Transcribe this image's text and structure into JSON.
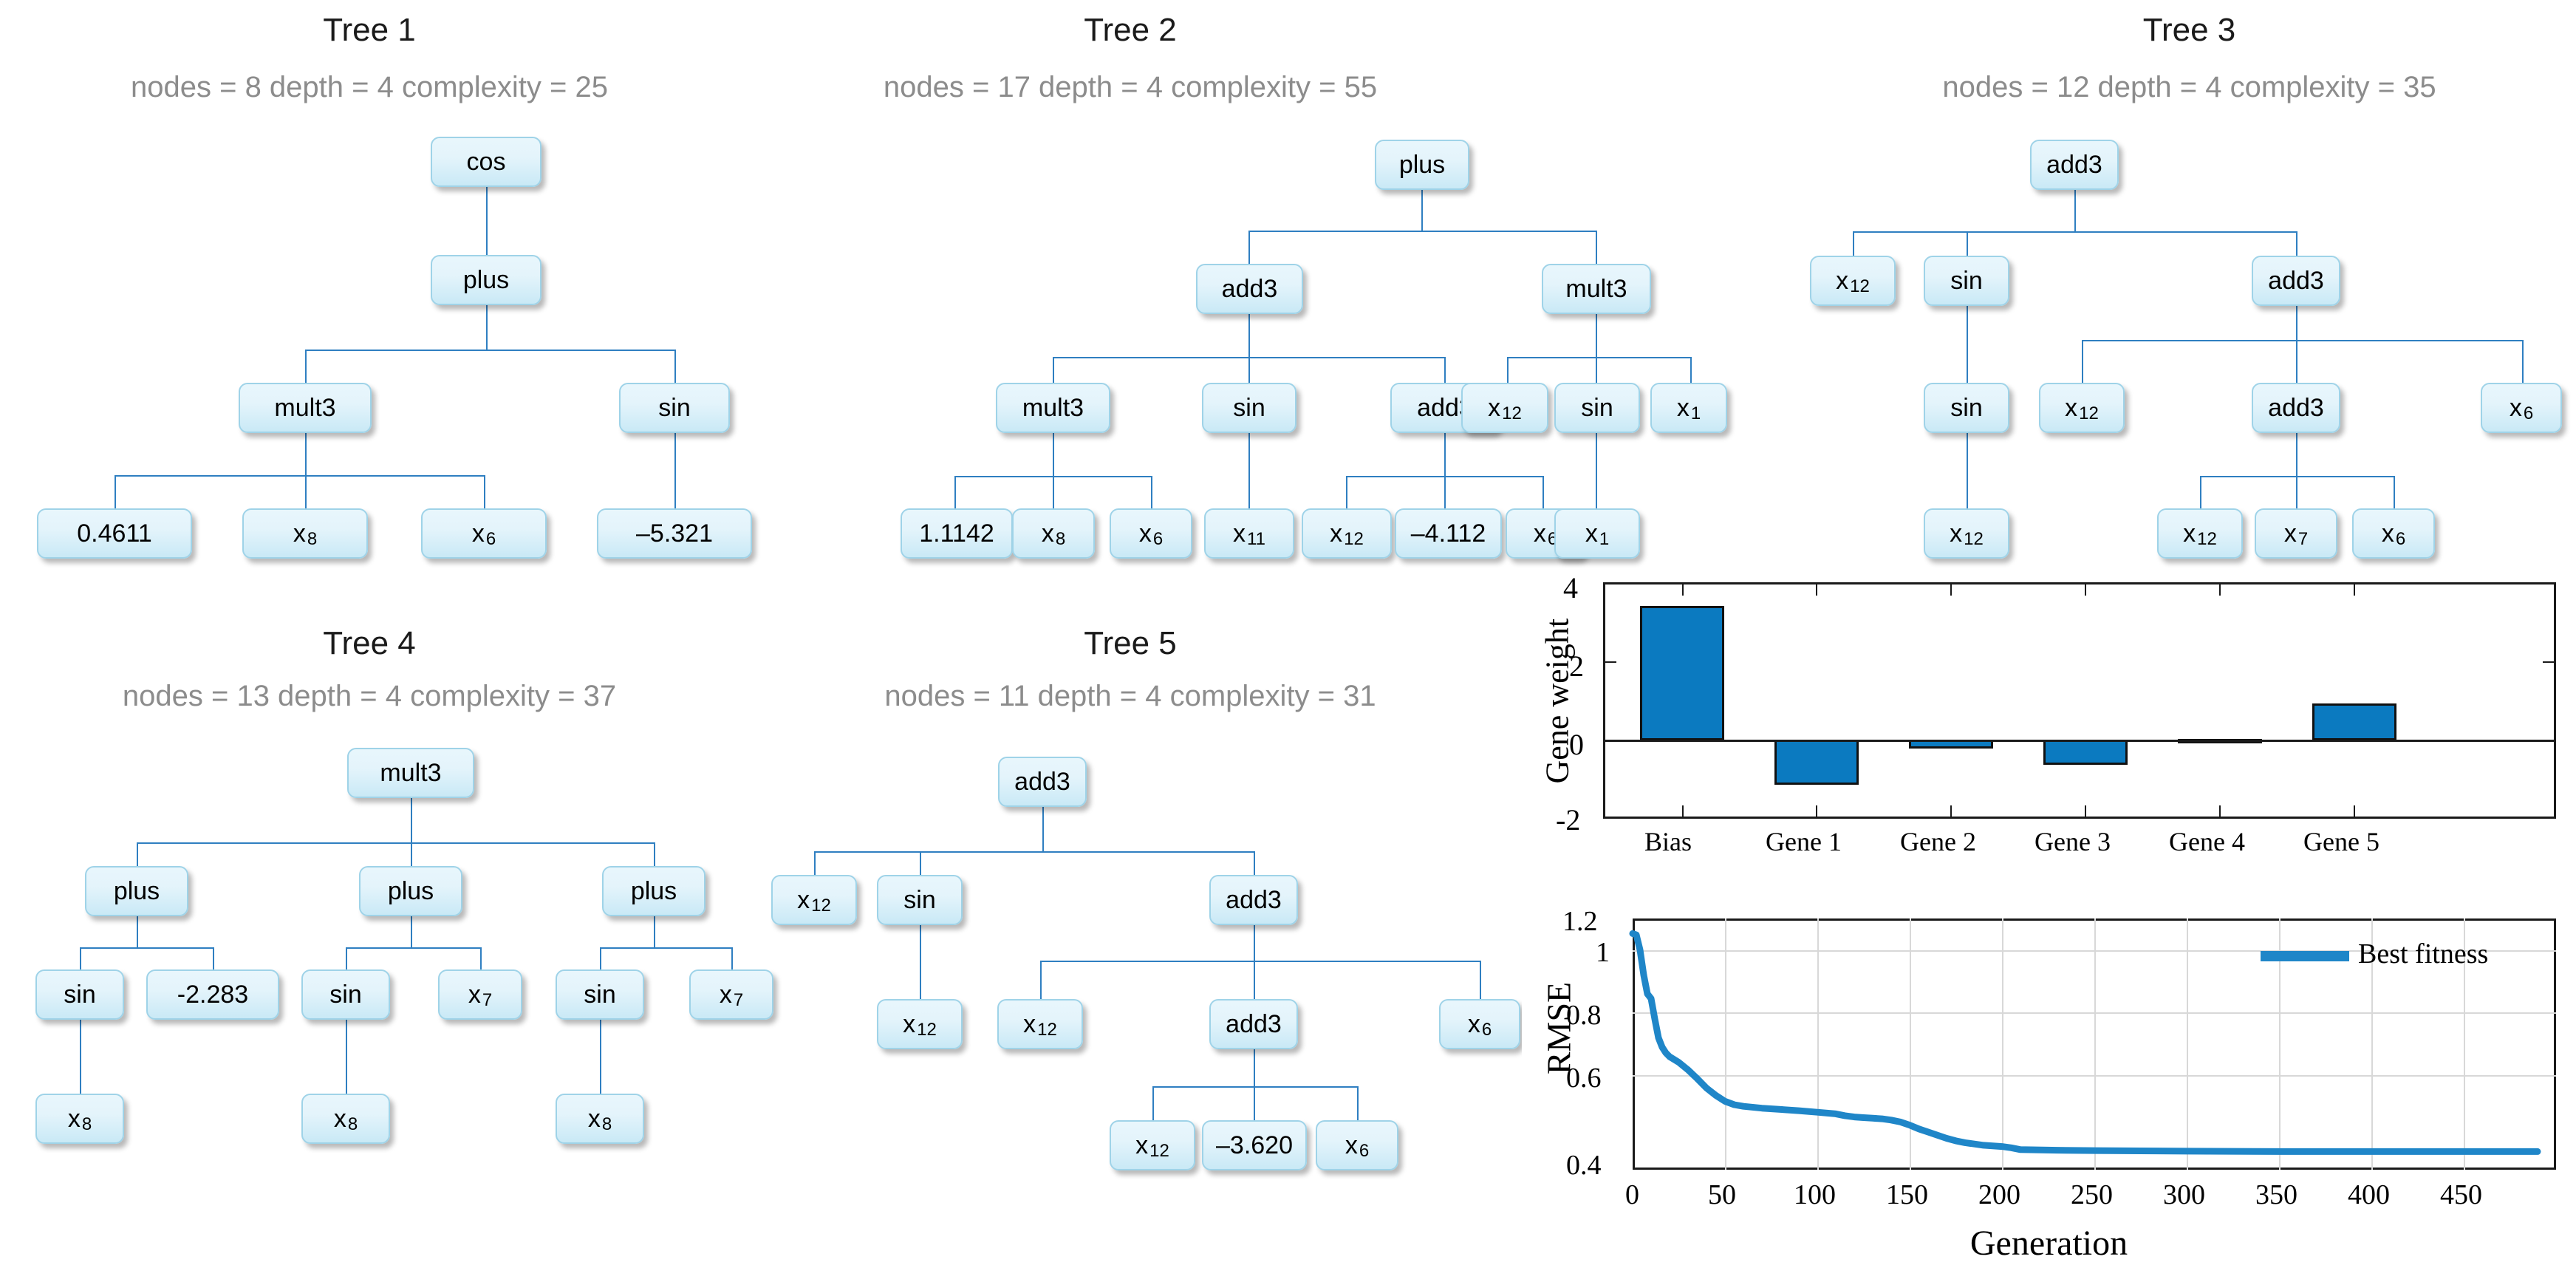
{
  "trees": [
    {
      "id": "tree-1",
      "title": "Tree 1",
      "stats": "nodes = 8 depth = 4 complexity = 25",
      "nodes": [
        {
          "label": "cos",
          "sub": ""
        },
        {
          "label": "plus",
          "sub": ""
        },
        {
          "label": "mult3",
          "sub": ""
        },
        {
          "label": "sin",
          "sub": ""
        },
        {
          "label": "0.4611",
          "sub": ""
        },
        {
          "label": "x",
          "sub": "8"
        },
        {
          "label": "x",
          "sub": "6"
        },
        {
          "label": "–5.321",
          "sub": ""
        }
      ]
    },
    {
      "id": "tree-2",
      "title": "Tree 2",
      "stats": "nodes = 17 depth = 4 complexity = 55",
      "nodes": [
        {
          "label": "plus",
          "sub": ""
        },
        {
          "label": "add3",
          "sub": ""
        },
        {
          "label": "mult3",
          "sub": ""
        },
        {
          "label": "mult3",
          "sub": ""
        },
        {
          "label": "sin",
          "sub": ""
        },
        {
          "label": "add3",
          "sub": ""
        },
        {
          "label": "x",
          "sub": "12"
        },
        {
          "label": "sin",
          "sub": ""
        },
        {
          "label": "x",
          "sub": "1"
        },
        {
          "label": "1.1142",
          "sub": ""
        },
        {
          "label": "x",
          "sub": "8"
        },
        {
          "label": "x",
          "sub": "6"
        },
        {
          "label": "x",
          "sub": "11"
        },
        {
          "label": "x",
          "sub": "12"
        },
        {
          "label": "–4.112",
          "sub": ""
        },
        {
          "label": "x",
          "sub": "6"
        },
        {
          "label": "x",
          "sub": "1"
        }
      ]
    },
    {
      "id": "tree-3",
      "title": "Tree 3",
      "stats": "nodes = 12 depth = 4 complexity = 35",
      "nodes": [
        {
          "label": "add3",
          "sub": ""
        },
        {
          "label": "x",
          "sub": "12"
        },
        {
          "label": "sin",
          "sub": ""
        },
        {
          "label": "add3",
          "sub": ""
        },
        {
          "label": "sin",
          "sub": ""
        },
        {
          "label": "x",
          "sub": "12"
        },
        {
          "label": "add3",
          "sub": ""
        },
        {
          "label": "x",
          "sub": "6"
        },
        {
          "label": "x",
          "sub": "12"
        },
        {
          "label": "x",
          "sub": "12"
        },
        {
          "label": "x",
          "sub": "7"
        },
        {
          "label": "x",
          "sub": "6"
        }
      ]
    },
    {
      "id": "tree-4",
      "title": "Tree 4",
      "stats": "nodes = 13 depth = 4 complexity = 37",
      "nodes": [
        {
          "label": "mult3",
          "sub": ""
        },
        {
          "label": "plus",
          "sub": ""
        },
        {
          "label": "plus",
          "sub": ""
        },
        {
          "label": "plus",
          "sub": ""
        },
        {
          "label": "sin",
          "sub": ""
        },
        {
          "label": "-2.283",
          "sub": ""
        },
        {
          "label": "sin",
          "sub": ""
        },
        {
          "label": "x",
          "sub": "7"
        },
        {
          "label": "sin",
          "sub": ""
        },
        {
          "label": "x",
          "sub": "7"
        },
        {
          "label": "x",
          "sub": "8"
        },
        {
          "label": "x",
          "sub": "8"
        },
        {
          "label": "x",
          "sub": "8"
        }
      ]
    },
    {
      "id": "tree-5",
      "title": "Tree 5",
      "stats": "nodes = 11 depth = 4 complexity = 31",
      "nodes": [
        {
          "label": "add3",
          "sub": ""
        },
        {
          "label": "x",
          "sub": "12"
        },
        {
          "label": "sin",
          "sub": ""
        },
        {
          "label": "add3",
          "sub": ""
        },
        {
          "label": "x",
          "sub": "12"
        },
        {
          "label": "x",
          "sub": "12"
        },
        {
          "label": "add3",
          "sub": ""
        },
        {
          "label": "x",
          "sub": "6"
        },
        {
          "label": "x",
          "sub": "12"
        },
        {
          "label": "–3.620",
          "sub": ""
        },
        {
          "label": "x",
          "sub": "6"
        }
      ]
    }
  ],
  "chart_data": [
    {
      "type": "bar",
      "id": "gene-weight-chart",
      "title": "",
      "xlabel": "",
      "ylabel": "Gene weight",
      "categories": [
        "Bias",
        "Gene 1",
        "Gene 2",
        "Gene 3",
        "Gene 4",
        "Gene 5"
      ],
      "values": [
        3.4,
        -1.14,
        -0.2,
        -0.63,
        0.02,
        0.91
      ],
      "ylim": [
        -2,
        4
      ],
      "yticks": [
        -2,
        0,
        2,
        4
      ],
      "ytick_labels": [
        "-2",
        "0",
        "2",
        "4"
      ],
      "grid": false,
      "bar_color": "#0b7ac0",
      "legend": null
    },
    {
      "type": "line",
      "id": "rmse-chart",
      "title": "",
      "xlabel": "Generation",
      "ylabel": "RMSE",
      "xlim": [
        0,
        500
      ],
      "ylim": [
        0.4,
        1.2
      ],
      "xticks": [
        0,
        50,
        100,
        150,
        200,
        250,
        300,
        350,
        400,
        450
      ],
      "xtick_labels": [
        "0",
        "50",
        "100",
        "150",
        "200",
        "250",
        "300",
        "350",
        "400",
        "450"
      ],
      "yticks": [
        0.4,
        0.6,
        0.8,
        1,
        1.2
      ],
      "ytick_labels": [
        "0.4",
        "0.6",
        "0.8",
        "1",
        "1.2"
      ],
      "grid": true,
      "legend": {
        "position": "top-right",
        "entries": [
          "Best fitness"
        ],
        "color": "#1f86c8"
      },
      "series": [
        {
          "name": "Best fitness",
          "color": "#1f86c8",
          "x": [
            0,
            2,
            4,
            6,
            8,
            10,
            12,
            14,
            16,
            18,
            20,
            25,
            30,
            35,
            40,
            45,
            50,
            55,
            60,
            70,
            80,
            90,
            100,
            110,
            115,
            120,
            125,
            130,
            135,
            140,
            145,
            150,
            155,
            160,
            165,
            170,
            175,
            180,
            190,
            200,
            205,
            210,
            230,
            250,
            275,
            300,
            350,
            400,
            450,
            490
          ],
          "y": [
            1.152,
            1.148,
            1.1,
            1.02,
            0.96,
            0.945,
            0.88,
            0.82,
            0.79,
            0.772,
            0.76,
            0.742,
            0.718,
            0.69,
            0.66,
            0.637,
            0.618,
            0.607,
            0.602,
            0.596,
            0.592,
            0.588,
            0.583,
            0.578,
            0.572,
            0.568,
            0.566,
            0.564,
            0.562,
            0.558,
            0.552,
            0.542,
            0.53,
            0.52,
            0.51,
            0.5,
            0.492,
            0.486,
            0.478,
            0.474,
            0.47,
            0.464,
            0.462,
            0.461,
            0.46,
            0.459,
            0.458,
            0.458,
            0.458,
            0.458
          ]
        }
      ]
    }
  ]
}
